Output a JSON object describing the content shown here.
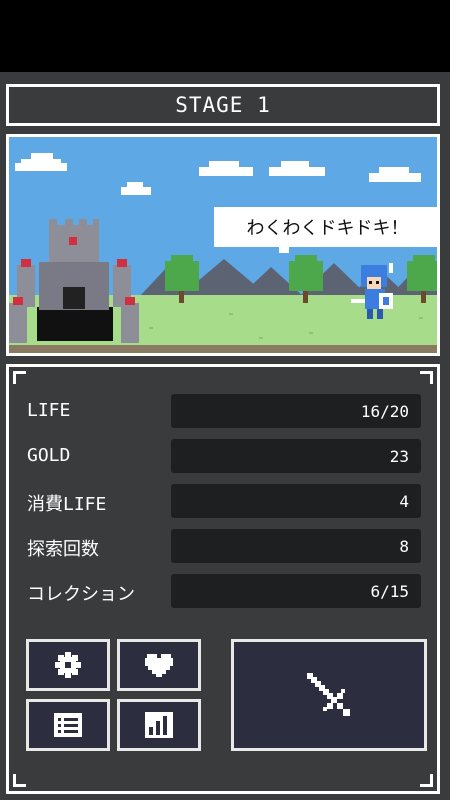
{
  "stage": {
    "title": "STAGE 1"
  },
  "scene": {
    "speech": "わくわくドキドキ！",
    "sky_color": "#5ea8e6",
    "grass_color": "#a6dc8a",
    "mountain_color": "#5c6474",
    "castle_color": "#8e8e98"
  },
  "stats": [
    {
      "label": "LIFE",
      "value": "16/20"
    },
    {
      "label": "GOLD",
      "value": "23"
    },
    {
      "label": "消費LIFE",
      "value": "4"
    },
    {
      "label": "探索回数",
      "value": "8"
    },
    {
      "label": "コレクション",
      "value": "6/15"
    }
  ],
  "buttons": {
    "settings": {
      "icon": "gear-icon"
    },
    "heart": {
      "icon": "heart-icon"
    },
    "list": {
      "icon": "list-icon"
    },
    "ranking": {
      "icon": "bar-chart-icon"
    },
    "attack": {
      "icon": "sword-icon"
    }
  },
  "colors": {
    "panel_bg": "#3a3b3d",
    "value_box": "#1e1f21",
    "button_bg": "#2c2d3f",
    "border": "#ffffff"
  }
}
